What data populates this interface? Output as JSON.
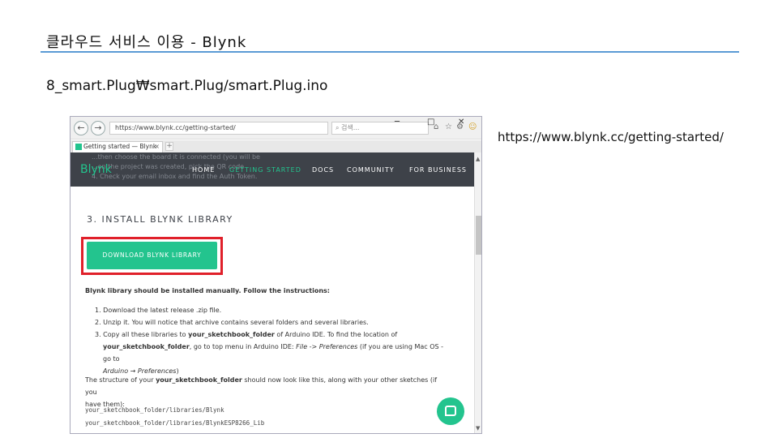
{
  "slide": {
    "title": "클라우드 서비스 이용 - Blynk",
    "path": "8_smart.Plug₩smart.Plug/smart.Plug.ino",
    "url_caption": "https://www.blynk.cc/getting-started/"
  },
  "browser": {
    "back_glyph": "←",
    "forward_glyph": "→",
    "address": "https://www.blynk.cc/getting-started/",
    "search_placeholder": "검색...",
    "search_glyph": "⌕",
    "home_glyph": "⌂",
    "star_glyph": "☆",
    "settings_glyph": "⚙",
    "smiley_glyph": "☺",
    "minimize_glyph": "─",
    "maximize_glyph": "□",
    "close_glyph": "✕",
    "tab_title": "Getting started — Blynk",
    "tab_close": "×",
    "new_tab": "+",
    "favicon_color": "#23c48e"
  },
  "site": {
    "brand": "Blynk",
    "ghost_lines": [
      "...then choose the board it is connected (you will be",
      "...on the project was created, pick the QR code",
      "4. Check your email inbox and find the Auth Token."
    ],
    "nav": [
      {
        "label": "HOME",
        "active": false
      },
      {
        "label": "GETTING STARTED",
        "active": true
      },
      {
        "label": "DOCS",
        "active": false
      },
      {
        "label": "COMMUNITY",
        "active": false
      },
      {
        "label": "FOR BUSINESS",
        "active": false
      }
    ],
    "accent_color": "#23c48e",
    "nav_bg_color": "#3e4249",
    "highlight_color": "#e0202a"
  },
  "content": {
    "step_heading": "3. INSTALL BLYNK LIBRARY",
    "download_button": "DOWNLOAD BLYNK LIBRARY",
    "note": "Blynk library should be installed manually. Follow the instructions:",
    "steps": {
      "s1": "1.  Download the latest release .zip file.",
      "s2": "2.  Unzip it. You will notice that archive contains several folders and several libraries.",
      "s3_a": "3.  Copy all these libraries to ",
      "s3_b": "your_sketchbook_folder",
      "s3_c": " of Arduino IDE. To find the location of",
      "s3_d": "your_sketchbook_folder",
      "s3_e": ", go to top menu in Arduino IDE: ",
      "s3_f": "File -> Preferences",
      "s3_g": " (if you are using Mac OS - go to",
      "s3_h": "Arduino → Preferences",
      "s3_i": ")"
    },
    "structure_a": "The structure of your ",
    "structure_b": "your_sketchbook_folder",
    "structure_c": " should now look like this, along with your other sketches (if you",
    "structure_d": "have them):",
    "code_lines": [
      "your_sketchbook_folder/libraries/Blynk",
      "your_sketchbook_folder/libraries/BlynkESP8266_Lib"
    ]
  }
}
